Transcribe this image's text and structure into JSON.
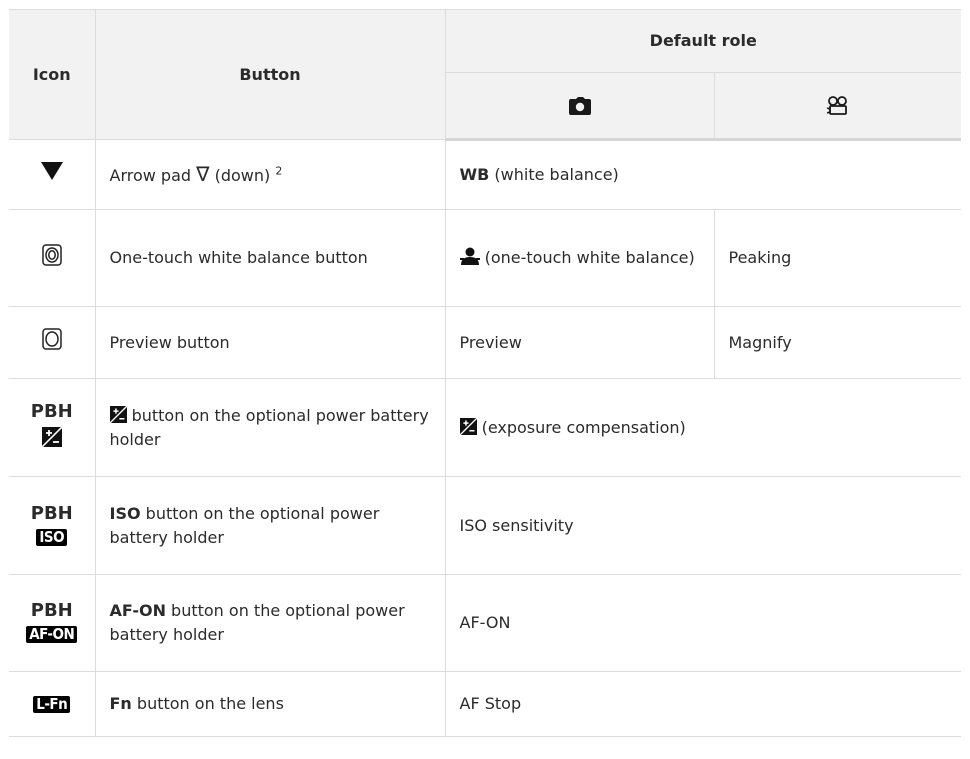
{
  "header": {
    "icon": "Icon",
    "button": "Button",
    "default_role": "Default role",
    "photo_icon": "camera-icon",
    "movie_icon": "movie-camera-icon"
  },
  "rows": [
    {
      "icon": "down-triangle-icon",
      "button_main": "Arrow pad ",
      "button_glyph": "∇",
      "button_tail": " (down) ",
      "button_sup": "2",
      "role_bold": "WB",
      "role_rest": " (white balance)"
    },
    {
      "icon": "one-touch-wb-icon",
      "button": "One-touch white balance button",
      "role_photo_icon": "one-touch-white-balance-icon",
      "role_photo": " (one-touch white balance)",
      "role_movie": "Peaking"
    },
    {
      "icon": "preview-icon",
      "button": "Preview button",
      "role_photo": "Preview",
      "role_movie": "Magnify"
    },
    {
      "icon_label": "PBH",
      "icon": "exposure-compensation-icon",
      "button": " button on the optional power battery holder",
      "role": " (exposure compensation)"
    },
    {
      "icon_label": "PBH",
      "icon_badge": "ISO",
      "button_bold": "ISO",
      "button": " button on the optional power battery holder",
      "role": "ISO sensitivity"
    },
    {
      "icon_label": "PBH",
      "icon_badge": "AF-ON",
      "button_bold": "AF-ON",
      "button": " button on the optional power battery holder",
      "role": "AF-ON"
    },
    {
      "icon_badge": "L-Fn",
      "button_bold": "Fn",
      "button": " button on the lens",
      "role": "AF Stop"
    }
  ]
}
